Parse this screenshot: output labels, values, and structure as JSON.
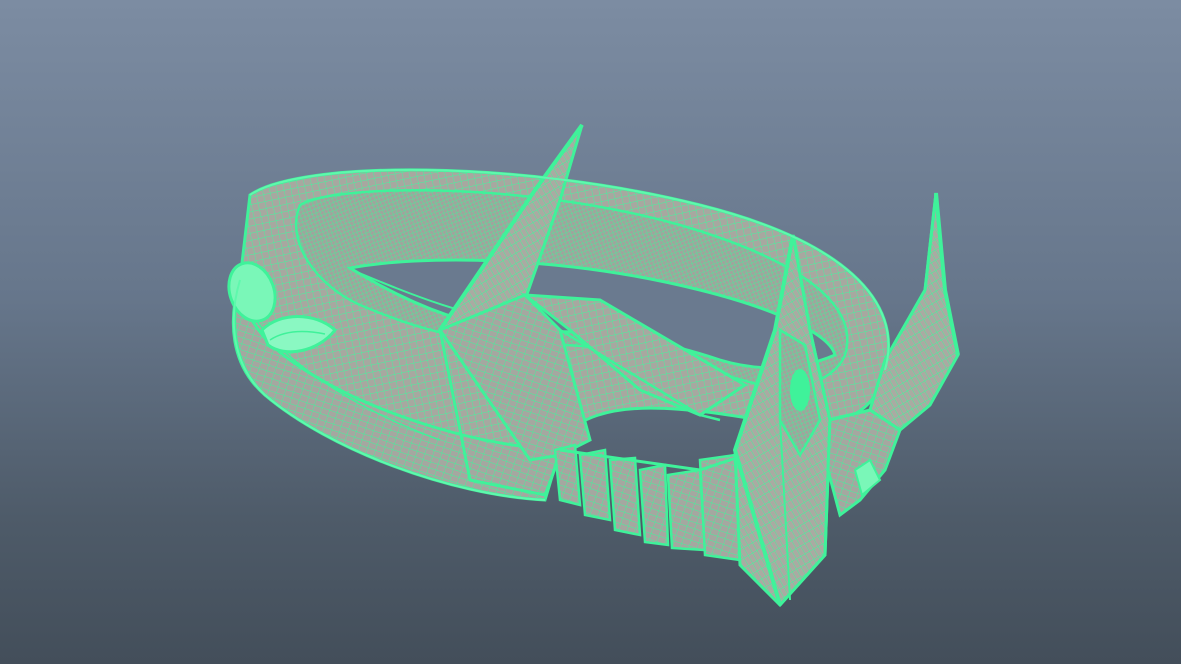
{
  "viewport": {
    "shading_mode": "wireframe-on-shaded",
    "object": "crown-ring-model",
    "wireframe_color": "#3ff29a",
    "shaded_color": "#a7a8a0",
    "background_top": "#7c8ca2",
    "background_bottom": "#434e5a"
  }
}
